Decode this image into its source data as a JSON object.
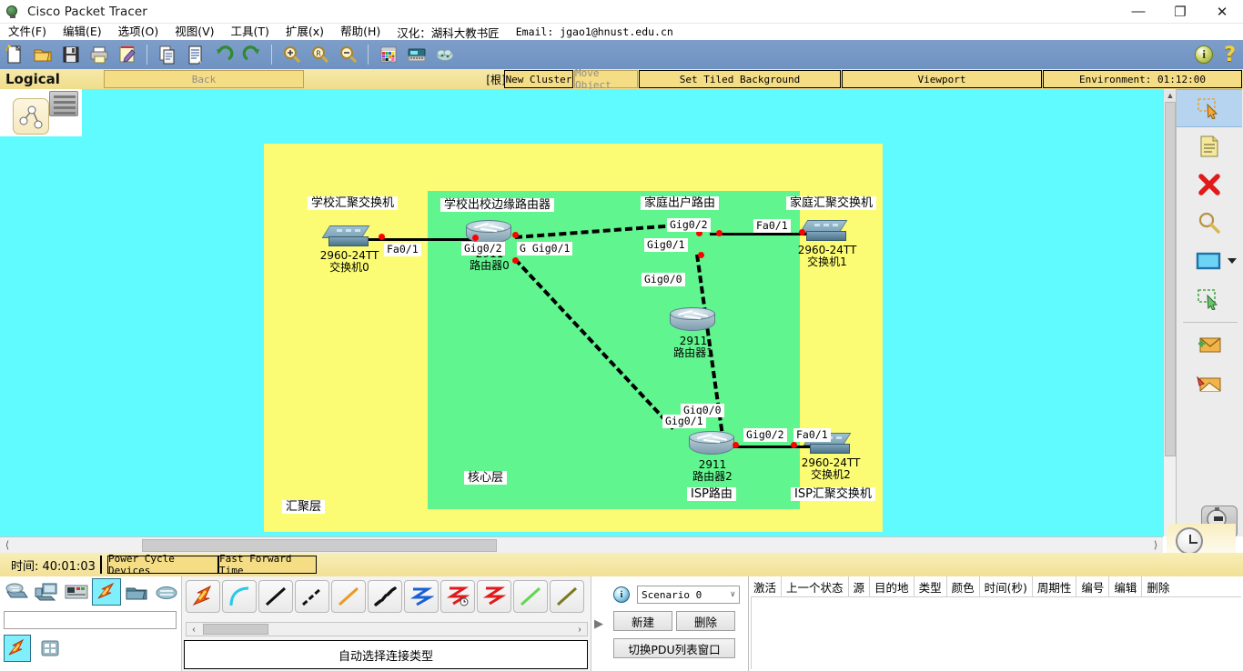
{
  "window": {
    "title": "Cisco Packet Tracer",
    "icon": "packet-tracer-icon",
    "minimize": "—",
    "maximize": "❐",
    "close": "✕"
  },
  "menubar": {
    "items": [
      {
        "label": "文件(F)",
        "name": "menu-file"
      },
      {
        "label": "编辑(E)",
        "name": "menu-edit"
      },
      {
        "label": "选项(O)",
        "name": "menu-options"
      },
      {
        "label": "视图(V)",
        "name": "menu-view"
      },
      {
        "label": "工具(T)",
        "name": "menu-tools"
      },
      {
        "label": "扩展(x)",
        "name": "menu-extensions"
      },
      {
        "label": "帮助(H)",
        "name": "menu-help"
      }
    ],
    "note_translation": "汉化：湖科大教书匠",
    "note_email": "Email: jgao1@hnust.edu.cn"
  },
  "toolbar": {
    "buttons": [
      {
        "name": "new-file-icon",
        "title": "新建"
      },
      {
        "name": "open-folder-icon",
        "title": "打开"
      },
      {
        "name": "save-icon",
        "title": "保存"
      },
      {
        "name": "print-icon",
        "title": "打印"
      },
      {
        "name": "activity-wizard-icon",
        "title": "活动向导"
      },
      {
        "name": "copy-icon",
        "title": "复制"
      },
      {
        "name": "paste-icon",
        "title": "粘贴"
      },
      {
        "name": "undo-icon",
        "title": "撤销"
      },
      {
        "name": "redo-icon",
        "title": "重做"
      },
      {
        "name": "zoom-in-icon",
        "title": "放大"
      },
      {
        "name": "zoom-reset-icon",
        "title": "原始大小"
      },
      {
        "name": "zoom-out-icon",
        "title": "缩小"
      },
      {
        "name": "palette-icon",
        "title": "调色板"
      },
      {
        "name": "custom-device-icon",
        "title": "自定义设备"
      },
      {
        "name": "network-cloud-icon",
        "title": "网络云"
      }
    ],
    "info_glyph": "i",
    "help_glyph": "?"
  },
  "logicalbar": {
    "mode_label": "Logical",
    "back_label": "Back",
    "root_label": "[根]",
    "new_cluster_label": "New Cluster",
    "move_object_label": "Move Object",
    "set_tiled_background_label": "Set Tiled Background",
    "viewport_label": "Viewport",
    "environment_label": "Environment: 01:12:00"
  },
  "canvas": {
    "zones": [
      {
        "name": "aggregation-zone",
        "label": "汇聚层",
        "color": "#fbfb74"
      },
      {
        "name": "core-zone",
        "label": "核心层",
        "color": "#61f58f"
      }
    ],
    "background": "#5ffbff",
    "devices": [
      {
        "name": "school-aggregation-switch",
        "title_box": "学校汇聚交换机",
        "model": "2960-24TT",
        "hostname": "交换机0",
        "type": "switch",
        "ports": [
          "Fa0/1"
        ]
      },
      {
        "name": "school-edge-router",
        "title_box": "学校出校边缘路由器",
        "model": "2911",
        "hostname": "路由器0",
        "type": "router",
        "ports": [
          "Gig0/2",
          "Gig0/1",
          "G"
        ]
      },
      {
        "name": "home-edge-router",
        "title_box": "家庭出户路由",
        "model": "2911",
        "hostname": "路由器1",
        "type": "router",
        "ports": [
          "Gig0/2",
          "Gig0/1",
          "Gig0/0"
        ]
      },
      {
        "name": "home-aggregation-switch",
        "title_box": "家庭汇聚交换机",
        "model": "2960-24TT",
        "hostname": "交换机1",
        "type": "switch",
        "ports": [
          "Fa0/1"
        ]
      },
      {
        "name": "isp-router",
        "title_box": "ISP路由",
        "model": "2911",
        "hostname": "路由器2",
        "type": "router",
        "ports": [
          "Gig0/0",
          "Gig0/1",
          "Gig0/2"
        ]
      },
      {
        "name": "isp-aggregation-switch",
        "title_box": "ISP汇聚交换机",
        "model": "2960-24TT",
        "hostname": "交换机2",
        "type": "switch",
        "ports": [
          "Fa0/1"
        ]
      }
    ]
  },
  "right_tools": [
    {
      "name": "select-tool",
      "icon": "select-arrow-icon",
      "active": true
    },
    {
      "name": "place-note-tool",
      "icon": "note-icon",
      "active": false
    },
    {
      "name": "delete-tool",
      "icon": "delete-x-icon",
      "active": false
    },
    {
      "name": "inspect-tool",
      "icon": "magnifier-icon",
      "active": false
    },
    {
      "name": "draw-shape-tool",
      "icon": "rectangle-icon",
      "active": false
    },
    {
      "name": "resize-shape-tool",
      "icon": "resize-arrow-icon",
      "active": false
    },
    {
      "name": "simple-pdu-tool",
      "icon": "envelope-add-icon",
      "active": false
    },
    {
      "name": "complex-pdu-tool",
      "icon": "envelope-open-icon",
      "active": false
    }
  ],
  "mode_switch": {
    "realtime_label": "Realtime",
    "realtime_icon": "clock-icon",
    "simulation_icon": "stopwatch-icon"
  },
  "timebar": {
    "time_label": "时间: 40:01:03",
    "power_cycle_label": "Power Cycle Devices",
    "fast_forward_label": "Fast Forward Time"
  },
  "device_palette": {
    "categories": [
      {
        "name": "network-devices-icon",
        "label": "网络设备",
        "selected": false
      },
      {
        "name": "end-devices-icon",
        "label": "终端设备",
        "selected": false
      },
      {
        "name": "components-icon",
        "label": "组件",
        "selected": false
      },
      {
        "name": "connections-icon",
        "label": "连接",
        "selected": true
      },
      {
        "name": "miscellaneous-icon",
        "label": "其他",
        "selected": false
      },
      {
        "name": "multiuser-cloud-icon",
        "label": "多用户连接",
        "selected": false
      }
    ],
    "search_value": "",
    "subcategories": [
      {
        "name": "connections-sub-icon",
        "selected": true
      },
      {
        "name": "grid-sub-icon",
        "selected": false
      }
    ]
  },
  "connections": {
    "items": [
      {
        "name": "auto-connection-icon",
        "label": "自动选择连接类型"
      },
      {
        "name": "console-cable-icon",
        "label": "控制台线"
      },
      {
        "name": "copper-straight-icon",
        "label": "铜直通线"
      },
      {
        "name": "copper-crossover-icon",
        "label": "铜交叉线"
      },
      {
        "name": "fiber-icon",
        "label": "光纤"
      },
      {
        "name": "phone-cable-icon",
        "label": "电话线"
      },
      {
        "name": "coaxial-icon",
        "label": "同轴电缆"
      },
      {
        "name": "serial-dce-icon",
        "label": "串行 DCE"
      },
      {
        "name": "serial-dte-icon",
        "label": "串行 DTE"
      },
      {
        "name": "octal-icon",
        "label": "八爪线"
      },
      {
        "name": "iot-custom-icon",
        "label": "IoT 自定义线"
      }
    ],
    "caption": "自动选择连接类型",
    "scroll_left": "‹",
    "scroll_right": "›"
  },
  "scenario": {
    "info_glyph": "i",
    "selected": "Scenario 0",
    "chevron": "∨",
    "new_label": "新建",
    "delete_label": "删除",
    "toggle_pdu_label": "切换PDU列表窗口",
    "expander": "▶"
  },
  "pdu_table": {
    "columns": [
      "激活",
      "上一个状态",
      "源",
      "目的地",
      "类型",
      "颜色",
      "时间(秒)",
      "周期性",
      "编号",
      "编辑",
      "删除"
    ],
    "rows": []
  }
}
